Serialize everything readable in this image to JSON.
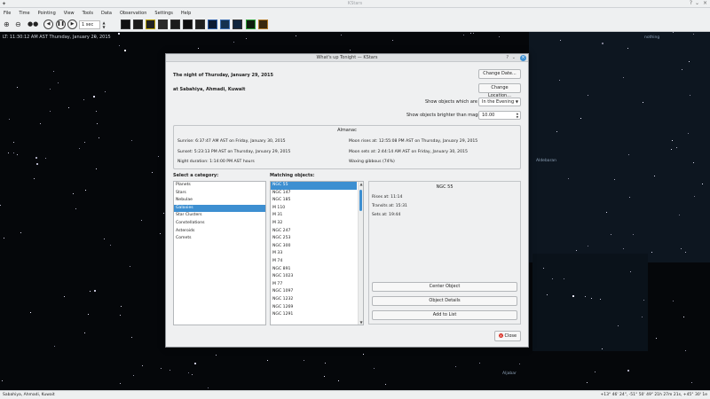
{
  "app": {
    "title": "KStars",
    "menu": [
      "File",
      "Time",
      "Pointing",
      "View",
      "Tools",
      "Data",
      "Observation",
      "Settings",
      "Help"
    ],
    "toolbar": {
      "time_step": "1 sec"
    },
    "sky_info": "LT: 11:30:12 AM AST  Thursday, January 29, 2015",
    "status_location": "Sabahiya, Ahmadi, Kuwait",
    "status_coords": "+13° 46' 24\", -51° 50' 49\"  21h 27m 21s, +45° 30' 1e",
    "sky_labels": {
      "top_right": "nothing",
      "mid": "Aldebaran",
      "bottom": "Aljabar"
    }
  },
  "dialog": {
    "title": "What's up Tonight — KStars",
    "night_label": "The night of Thursday, January 29, 2015",
    "location_label": "at Sabahiya, Ahmadi, Kuwait",
    "change_date": "Change Date...",
    "change_location": "Change Location...",
    "show_objects_label": "Show objects which are up:",
    "show_objects_value": "In the Evening",
    "magnitude_label": "Show objects brighter than magnitude:",
    "magnitude_value": "10.00",
    "almanac": {
      "title": "Almanac",
      "sunrise": "Sunrise: 6:37:47 AM AST on Friday, January 30, 2015",
      "sunset": "Sunset: 5:23:13 PM AST on Thursday, January 29, 2015",
      "night_duration": "Night duration: 1:14:00 PM AST hours",
      "moonrise": "Moon rises at: 12:55:08 PM AST on Thursday, January 29, 2015",
      "moonset": "Moon sets at: 2:44:14 AM AST on Friday, January 30, 2015",
      "phase": "Waxing gibbous (74%)"
    },
    "category_title": "Select a category:",
    "categories": [
      "Planets",
      "Stars",
      "Nebulae",
      "Galaxies",
      "Star Clusters",
      "Constellations",
      "Asteroids",
      "Comets"
    ],
    "selected_category": 3,
    "matching_title": "Matching objects:",
    "objects": [
      "NGC 55",
      "NGC 147",
      "NGC 185",
      "M 110",
      "M 31",
      "M 32",
      "NGC 247",
      "NGC 253",
      "NGC 300",
      "M 33",
      "M 74",
      "NGC 891",
      "NGC 1023",
      "M 77",
      "NGC 1097",
      "NGC 1232",
      "NGC 1269",
      "NGC 1291"
    ],
    "selected_object": 0,
    "details": {
      "name": "NGC 55",
      "rises": "Rises at: 11:14",
      "transits": "Transits at: 15:31",
      "sets": "Sets at: 19:44"
    },
    "center_object": "Center Object",
    "object_details": "Object Details",
    "add_to_list": "Add to List",
    "close": "Close"
  }
}
